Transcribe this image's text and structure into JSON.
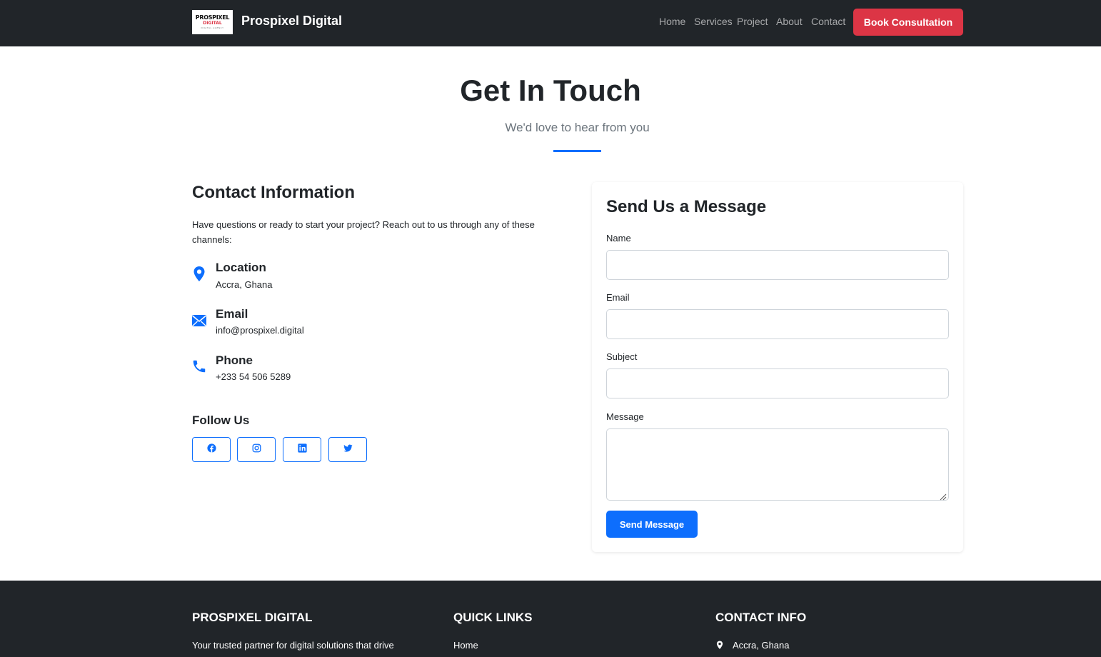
{
  "navbar": {
    "logo_text": [
      "PROSPIXEL",
      "DIGITAL",
      "DIGITAL AGENCY"
    ],
    "brand_name": "Prospixel Digital",
    "links": [
      "Home",
      "Services",
      "Project",
      "About",
      "Contact"
    ],
    "cta_label": "Book Consultation"
  },
  "hero": {
    "title": "Get In Touch",
    "subtitle": "We'd love to hear from you"
  },
  "contact_info": {
    "heading": "Contact Information",
    "intro": "Have questions or ready to start your project? Reach out to us through any of these channels:",
    "items": [
      {
        "icon": "location-pin-icon",
        "title": "Location",
        "value": "Accra, Ghana"
      },
      {
        "icon": "envelope-icon",
        "title": "Email",
        "value": "info@prospixel.digital"
      },
      {
        "icon": "phone-icon",
        "title": "Phone",
        "value": "+233 54 506 5289"
      }
    ],
    "follow_heading": "Follow Us",
    "social": [
      "facebook-icon",
      "instagram-icon",
      "linkedin-icon",
      "twitter-icon"
    ]
  },
  "form": {
    "heading": "Send Us a Message",
    "fields": {
      "name_label": "Name",
      "name_value": "",
      "email_label": "Email",
      "email_value": "",
      "subject_label": "Subject",
      "subject_value": "",
      "message_label": "Message",
      "message_value": ""
    },
    "submit_label": "Send Message"
  },
  "footer": {
    "columns": [
      {
        "heading": "PROSPIXEL DIGITAL",
        "text": "Your trusted partner for digital solutions that drive"
      },
      {
        "heading": "QUICK LINKS",
        "text": "Home"
      },
      {
        "heading": "CONTACT INFO",
        "text": "Accra, Ghana"
      }
    ]
  },
  "colors": {
    "dark": "#212529",
    "accent": "#0d6efd",
    "cta": "#dc3545",
    "muted": "#6c757d"
  }
}
